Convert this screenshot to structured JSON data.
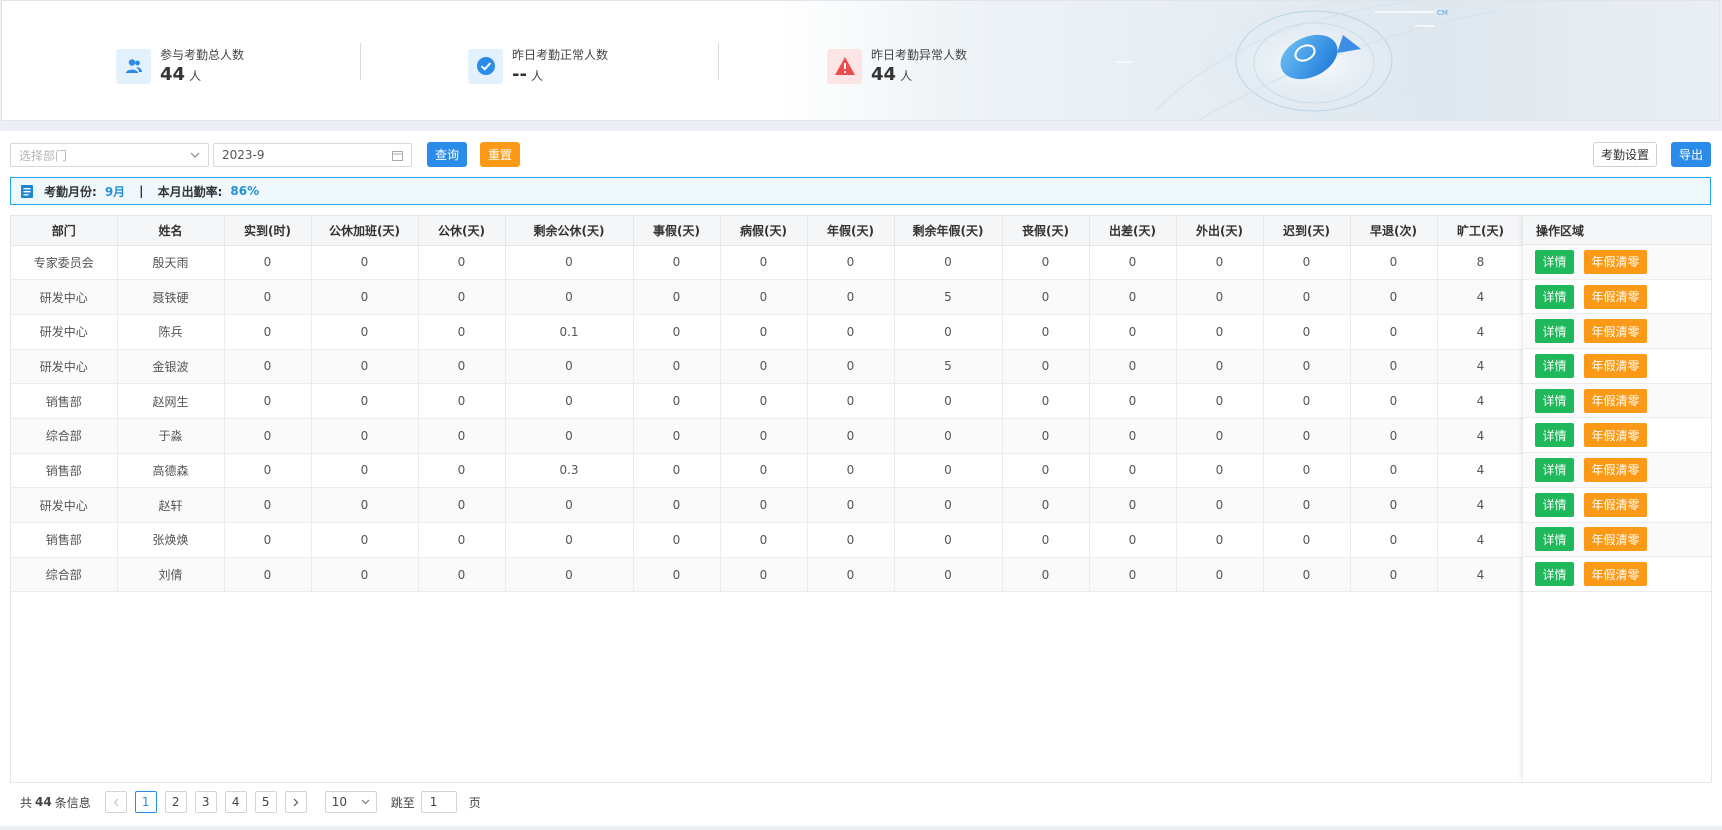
{
  "stats": [
    {
      "label": "参与考勤总人数",
      "value": "44",
      "unit": "人",
      "icon": "users-icon",
      "color": "#2b8be8"
    },
    {
      "label": "昨日考勤正常人数",
      "value": "--",
      "unit": "人",
      "icon": "check-circle-icon",
      "color": "#2b8be8"
    },
    {
      "label": "昨日考勤异常人数",
      "value": "44",
      "unit": "人",
      "icon": "warning-icon",
      "color": "#ef4d4d"
    }
  ],
  "filters": {
    "department_placeholder": "选择部门",
    "month_value": "2023-9",
    "query_label": "查询",
    "reset_label": "重置",
    "settings_label": "考勤设置",
    "export_label": "导出"
  },
  "info": {
    "month_key": "考勤月份:",
    "month_value": "9月",
    "separator": "|",
    "rate_key": "本月出勤率:",
    "rate_value": "86%"
  },
  "table": {
    "columns": [
      "部门",
      "姓名",
      "实到(时)",
      "公休加班(天)",
      "公休(天)",
      "剩余公休(天)",
      "事假(天)",
      "病假(天)",
      "年假(天)",
      "剩余年假(天)",
      "丧假(天)",
      "出差(天)",
      "外出(天)",
      "迟到(天)",
      "早退(次)",
      "旷工(天)"
    ],
    "ops_header": "操作区域",
    "detail_label": "详情",
    "clear_label": "年假清零",
    "rows": [
      [
        "专家委员会",
        "殷天雨",
        "0",
        "0",
        "0",
        "0",
        "0",
        "0",
        "0",
        "0",
        "0",
        "0",
        "0",
        "0",
        "0",
        "8"
      ],
      [
        "研发中心",
        "聂铁硬",
        "0",
        "0",
        "0",
        "0",
        "0",
        "0",
        "0",
        "5",
        "0",
        "0",
        "0",
        "0",
        "0",
        "4"
      ],
      [
        "研发中心",
        "陈兵",
        "0",
        "0",
        "0",
        "0.1",
        "0",
        "0",
        "0",
        "0",
        "0",
        "0",
        "0",
        "0",
        "0",
        "4"
      ],
      [
        "研发中心",
        "金银波",
        "0",
        "0",
        "0",
        "0",
        "0",
        "0",
        "0",
        "5",
        "0",
        "0",
        "0",
        "0",
        "0",
        "4"
      ],
      [
        "销售部",
        "赵网生",
        "0",
        "0",
        "0",
        "0",
        "0",
        "0",
        "0",
        "0",
        "0",
        "0",
        "0",
        "0",
        "0",
        "4"
      ],
      [
        "综合部",
        "于淼",
        "0",
        "0",
        "0",
        "0",
        "0",
        "0",
        "0",
        "0",
        "0",
        "0",
        "0",
        "0",
        "0",
        "4"
      ],
      [
        "销售部",
        "高德森",
        "0",
        "0",
        "0",
        "0.3",
        "0",
        "0",
        "0",
        "0",
        "0",
        "0",
        "0",
        "0",
        "0",
        "4"
      ],
      [
        "研发中心",
        "赵轩",
        "0",
        "0",
        "0",
        "0",
        "0",
        "0",
        "0",
        "0",
        "0",
        "0",
        "0",
        "0",
        "0",
        "4"
      ],
      [
        "销售部",
        "张焕焕",
        "0",
        "0",
        "0",
        "0",
        "0",
        "0",
        "0",
        "0",
        "0",
        "0",
        "0",
        "0",
        "0",
        "4"
      ],
      [
        "综合部",
        "刘倩",
        "0",
        "0",
        "0",
        "0",
        "0",
        "0",
        "0",
        "0",
        "0",
        "0",
        "0",
        "0",
        "0",
        "4"
      ]
    ]
  },
  "pagination": {
    "total_prefix": "共",
    "total": "44",
    "total_suffix": "条信息",
    "pages": [
      "1",
      "2",
      "3",
      "4",
      "5"
    ],
    "current": "1",
    "page_size": "10",
    "jump_prefix": "跳至",
    "jump_value": "1",
    "jump_suffix": "页"
  }
}
